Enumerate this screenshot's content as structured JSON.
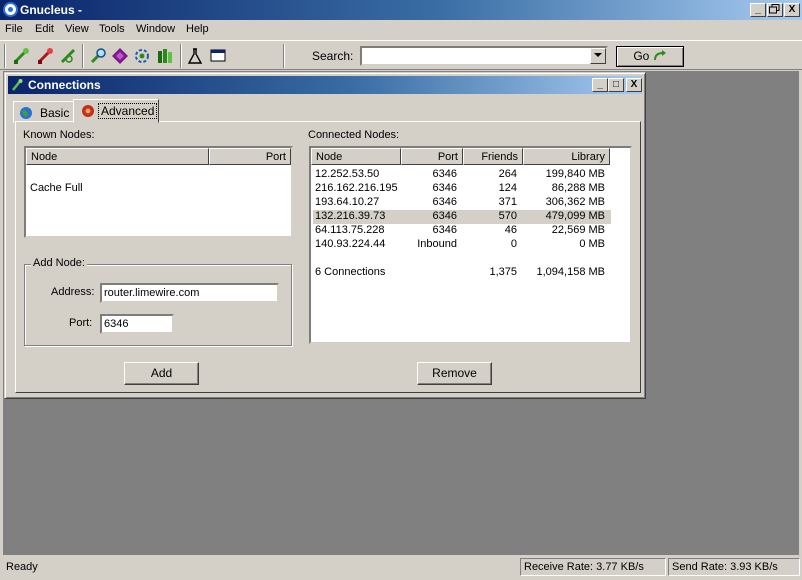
{
  "app": {
    "title": "Gnucleus -",
    "caption_buttons": [
      "_",
      "Θ",
      "X"
    ]
  },
  "menu": [
    "File",
    "Edit",
    "View",
    "Tools",
    "Window",
    "Help"
  ],
  "toolbar": {
    "icons": [
      "connect-icon",
      "disconnect-icon",
      "node-icon",
      "search-tool-icon",
      "shield-icon",
      "transfer-icon",
      "library-icon",
      "flask-icon",
      "window-icon"
    ],
    "search_label": "Search:",
    "search_value": "",
    "go_label": "Go"
  },
  "connections_window": {
    "title": "Connections",
    "caption_buttons": [
      "_",
      "□",
      "X"
    ],
    "tabs": [
      {
        "label": "Basic",
        "active": false
      },
      {
        "label": "Advanced",
        "active": true
      }
    ],
    "known_nodes": {
      "label": "Known Nodes:",
      "columns": [
        "Node",
        "Port"
      ],
      "rows": [
        "Cache Full"
      ]
    },
    "add_node": {
      "label": "Add Node:",
      "address_label": "Address:",
      "address_value": "router.limewire.com",
      "port_label": "Port:",
      "port_value": "6346",
      "add_button": "Add"
    },
    "connected_nodes": {
      "label": "Connected Nodes:",
      "columns": [
        "Node",
        "Port",
        "Friends",
        "Library"
      ],
      "rows": [
        {
          "node": "12.252.53.50",
          "port": "6346",
          "friends": "264",
          "library": "199,840 MB",
          "selected": false
        },
        {
          "node": "216.162.216.195",
          "port": "6346",
          "friends": "124",
          "library": "86,288 MB",
          "selected": false
        },
        {
          "node": "193.64.10.27",
          "port": "6346",
          "friends": "371",
          "library": "306,362 MB",
          "selected": false
        },
        {
          "node": "132.216.39.73",
          "port": "6346",
          "friends": "570",
          "library": "479,099 MB",
          "selected": true
        },
        {
          "node": "64.113.75.228",
          "port": "6346",
          "friends": "46",
          "library": "22,569 MB",
          "selected": false
        },
        {
          "node": "140.93.224.44",
          "port": "Inbound",
          "friends": "0",
          "library": "0 MB",
          "selected": false
        }
      ],
      "summary": {
        "node": "6 Connections",
        "friends": "1,375",
        "library": "1,094,158 MB"
      },
      "remove_button": "Remove"
    }
  },
  "status": {
    "ready": "Ready",
    "receive_rate": "Receive Rate:  3.77 KB/s",
    "send_rate": "Send Rate:  3.93 KB/s"
  }
}
